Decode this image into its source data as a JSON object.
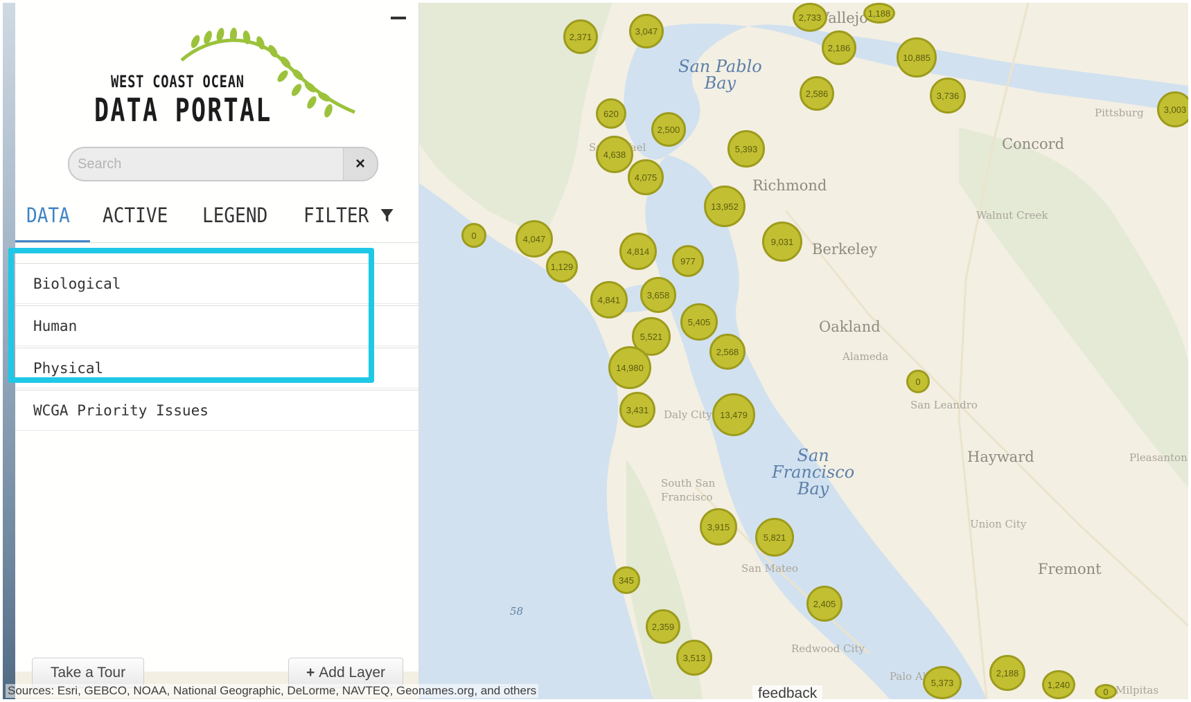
{
  "sidebar": {
    "logo": {
      "line1": "WEST COAST OCEAN",
      "line2": "DATA PORTAL"
    },
    "search": {
      "placeholder": "Search",
      "clear_icon": "×"
    },
    "tabs": [
      {
        "label": "DATA",
        "active": true
      },
      {
        "label": "ACTIVE",
        "active": false
      },
      {
        "label": "LEGEND",
        "active": false
      },
      {
        "label": "FILTER",
        "active": false,
        "icon": "filter-icon"
      }
    ],
    "categories": [
      {
        "label": "Biological",
        "highlighted": true
      },
      {
        "label": "Human",
        "highlighted": true
      },
      {
        "label": "Physical",
        "highlighted": true
      },
      {
        "label": "WCGA Priority Issues",
        "highlighted": false
      }
    ],
    "footer": {
      "tour_label": "Take a Tour",
      "add_layer_label": "Add Layer",
      "add_icon": "+"
    }
  },
  "map": {
    "water_labels": [
      {
        "lines": [
          "San Pablo",
          "Bay"
        ]
      },
      {
        "lines": [
          "San",
          "Francisco",
          "Bay"
        ]
      }
    ],
    "places": [
      "Concord",
      "Richmond",
      "Walnut Creek",
      "Berkeley",
      "Oakland",
      "Alameda",
      "San Leandro",
      "Hayward",
      "Union City",
      "Fremont",
      "Pleasanton",
      "San Mateo",
      "Redwood City",
      "Daly City",
      "South San Francisco",
      "Pittsburg",
      "San Rafael",
      "Vallejo",
      "Palo Alto",
      "Milpitas",
      "58"
    ],
    "clusters": [
      "2,371",
      "3,047",
      "2,733",
      "1,188",
      "2,186",
      "10,885",
      "2,586",
      "3,736",
      "3,003",
      "620",
      "2,500",
      "4,638",
      "4,075",
      "5,393",
      "13,952",
      "0",
      "4,047",
      "1,129",
      "4,814",
      "977",
      "9,031",
      "4,841",
      "3,658",
      "5,405",
      "5,521",
      "2,568",
      "14,980",
      "3,431",
      "13,479",
      "0",
      "3,915",
      "5,821",
      "345",
      "2,405",
      "2,359",
      "3,513",
      "5,373",
      "2,188",
      "1,240",
      "0"
    ],
    "attribution": "Sources: Esri, GEBCO, NOAA, National Geographic, DeLorme, NAVTEQ, Geonames.org, and others",
    "feedback": "feedback",
    "colors": {
      "water": "#d2e1ef",
      "land": "#f3efe3",
      "cluster": "#c2c032",
      "highlight": "#1ec8e6",
      "accent": "#3f84c4"
    }
  }
}
